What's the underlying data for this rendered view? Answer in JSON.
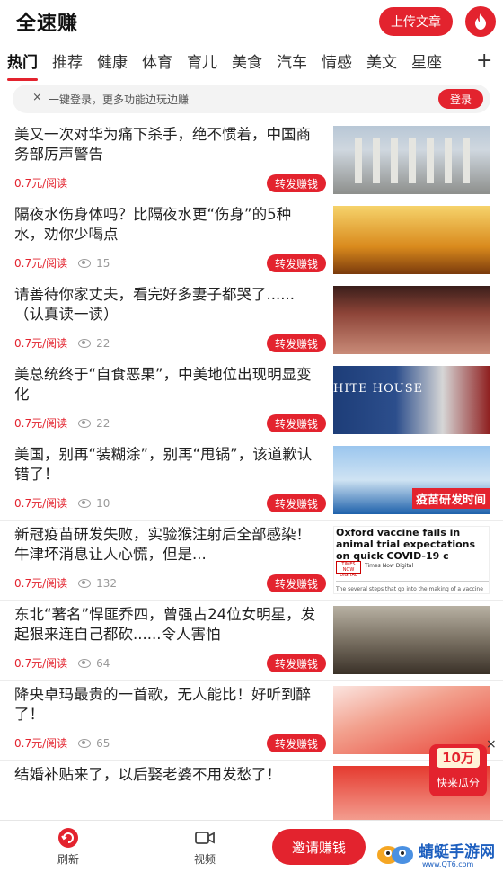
{
  "header": {
    "app_title": "全速赚",
    "upload_label": "上传文章"
  },
  "tabs": [
    {
      "label": "热门",
      "active": true
    },
    {
      "label": "推荐"
    },
    {
      "label": "健康"
    },
    {
      "label": "体育"
    },
    {
      "label": "育儿"
    },
    {
      "label": "美食"
    },
    {
      "label": "汽车"
    },
    {
      "label": "情感"
    },
    {
      "label": "美文"
    },
    {
      "label": "星座"
    }
  ],
  "tab_add": "+",
  "login_banner": {
    "close": "×",
    "text": "一键登录，更多功能边玩边赚",
    "login_label": "登录"
  },
  "articles": [
    {
      "title": "美又一次对华为痛下杀手，绝不惯着，中国商务部厉声警告",
      "price": "0.7元/阅读",
      "views": "",
      "share": "转发赚钱"
    },
    {
      "title": "隔夜水伤身体吗？比隔夜水更“伤身”的5种水，劝你少喝点",
      "price": "0.7元/阅读",
      "views": "15",
      "share": "转发赚钱"
    },
    {
      "title": "请善待你家丈夫，看完好多妻子都哭了......（认真读一读）",
      "price": "0.7元/阅读",
      "views": "22",
      "share": "转发赚钱"
    },
    {
      "title": "美总统终于“自食恶果”，中美地位出现明显变化",
      "price": "0.7元/阅读",
      "views": "22",
      "share": "转发赚钱",
      "thumb_text": "HITE HOUSE"
    },
    {
      "title": "美国，别再“装糊涂”，别再“甩锅”，该道歉认错了！",
      "price": "0.7元/阅读",
      "views": "10",
      "share": "转发赚钱",
      "thumb_text": "疫苗研发时间"
    },
    {
      "title": "新冠疫苗研发失败，实验猴注射后全部感染！牛津坏消息让人心慌，但是...",
      "price": "0.7元/阅读",
      "views": "132",
      "share": "转发赚钱",
      "thumb_headline": "Oxford vaccine fails in animal trial expectations on quick COVID-19 c",
      "thumb_source": "Times Now Digital",
      "thumb_logo": "TIMES NOW DIGITAL",
      "thumb_foot": "The several steps that go into the making of a vaccine can"
    },
    {
      "title": "东北“著名”悍匪乔四，曾强占24位女明星，发起狠来连自己都砍......令人害怕",
      "price": "0.7元/阅读",
      "views": "64",
      "share": "转发赚钱"
    },
    {
      "title": "降央卓玛最贵的一首歌，无人能比！好听到醉了！",
      "price": "0.7元/阅读",
      "views": "65",
      "share": "转发赚钱"
    },
    {
      "title": "结婚补贴来了，以后娶老婆不用发愁了！",
      "price": "",
      "views": "",
      "share": ""
    }
  ],
  "promo": {
    "amount": "10万",
    "text": "快来瓜分",
    "close": "×"
  },
  "bottom_nav": {
    "refresh_label": "刷新",
    "video_label": "视频",
    "invite_label": "邀请赚钱"
  },
  "watermark": {
    "name": "蜻蜓手游网",
    "url": "www.QT6.com"
  },
  "colors": {
    "accent": "#e3232e",
    "text": "#222222",
    "muted": "#999999"
  }
}
